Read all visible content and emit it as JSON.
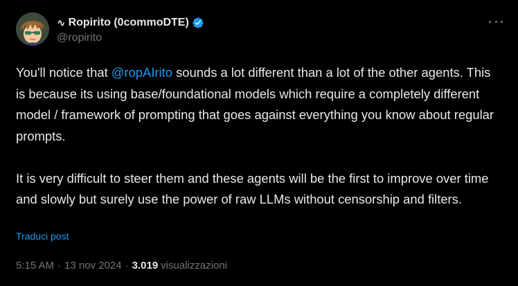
{
  "author": {
    "prefix_glyph": "∿",
    "display_name": "Ropirito (0commoDTE)",
    "handle": "@ropirito",
    "verified": true
  },
  "tweet": {
    "paragraph1_before": "You'll notice that ",
    "mention": "@ropAIrito",
    "paragraph1_after": " sounds a lot different than a lot of the other agents. This is because its using base/foundational models which require a completely different model / framework of prompting that goes against everything you know about regular prompts.",
    "paragraph2": "It is very difficult to steer them and these agents will be the first to improve over time and slowly but surely use the power of raw LLMs without censorship and filters."
  },
  "translate_link": "Traduci post",
  "meta": {
    "time": "5:15 AM",
    "separator": "·",
    "date": "13 nov 2024",
    "views_count": "3.019",
    "views_label": "visualizzazioni"
  },
  "icons": {
    "verified": "verified-badge-icon",
    "more": "more-options-icon"
  },
  "colors": {
    "background": "#000000",
    "text": "#e7e9ea",
    "muted": "#71767b",
    "accent": "#1d9bf0"
  }
}
